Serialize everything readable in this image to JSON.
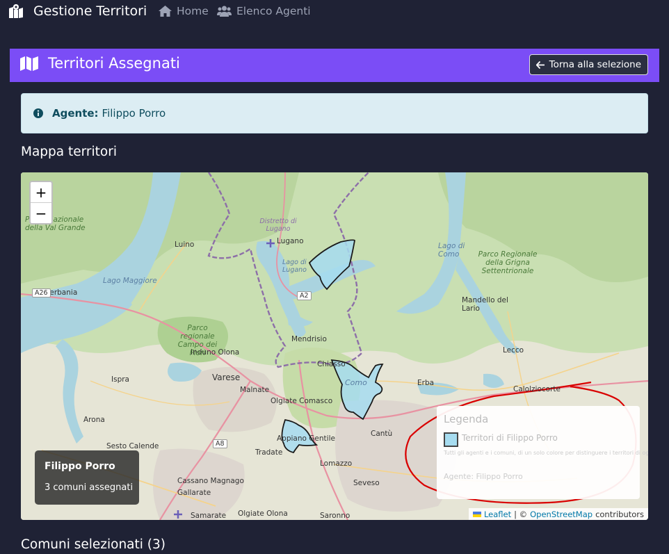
{
  "navbar": {
    "brand": "Gestione Territori",
    "links": [
      {
        "label": "Home",
        "icon": "home-icon"
      },
      {
        "label": "Elenco Agenti",
        "icon": "users-icon"
      }
    ]
  },
  "header": {
    "title": "Territori Assegnati",
    "back_button": "Torna alla selezione"
  },
  "alert": {
    "label": "Agente:",
    "value": "Filippo Porro"
  },
  "map_section": {
    "title": "Mappa territori",
    "zoom_in": "+",
    "zoom_out": "−",
    "agent_box": {
      "name": "Filippo Porro",
      "count": "3 comuni assegnati"
    },
    "legend": {
      "title": "Legenda",
      "item": "Territori di Filippo Porro",
      "note": "Tutti gli agenti e i comuni, di un solo colore per distinguere i territori di ognuno",
      "agent": "Agente: Filippo Porro"
    },
    "attribution": {
      "leaflet": "Leaflet",
      "sep": "| ©",
      "osm": "OpenStreetMap",
      "suffix": "contributors"
    },
    "labels": {
      "lugano": "Lugano",
      "luino": "Luino",
      "verbania": "Verbania",
      "varese": "Varese",
      "mendrisio": "Mendrisio",
      "como": "Como",
      "lecco": "Lecco",
      "erba": "Erba",
      "cantu": "Cantù",
      "arona": "Arona",
      "ispra": "Ispra",
      "malnate": "Malnate",
      "olgiate_comasco": "Olgiate Comasco",
      "appiano": "Appiano Gentile",
      "tradate": "Tradate",
      "lomazzo": "Lomazzo",
      "seveso": "Seveso",
      "saronno": "Saronno",
      "gallarate": "Gallarate",
      "samarate": "Samarate",
      "cassano": "Cassano Magnago",
      "sesto": "Sesto Calende",
      "induno": "Induno Olona",
      "chiasso": "Chiasso",
      "mandello": "Mandello del Lario",
      "calolziocorte": "Calolziocorte",
      "lago_maggiore": "Lago Maggiore",
      "lago_como": "Lago di Como",
      "lago_lugano": "Lago di Lugano",
      "campo_fiori": "Parco regionale Campo dei Fiori",
      "grigna": "Parco Regionale della Grigna Settentrionale",
      "val_grande": "Parco Nazionale della Val Grande",
      "distretto": "Distretto di Lugano",
      "olgiate_olona": "Olgiate Olona",
      "a26": "A26",
      "a2": "A2",
      "a8": "A8"
    }
  },
  "selected_section": {
    "title": "Comuni selezionati (3)"
  },
  "colors": {
    "navbar_bg": "#1f2235",
    "header_bg": "#7b4df6",
    "alert_bg": "#dcedf3",
    "territory_fill": "#a6dcf0",
    "annotation": "#d90000"
  }
}
